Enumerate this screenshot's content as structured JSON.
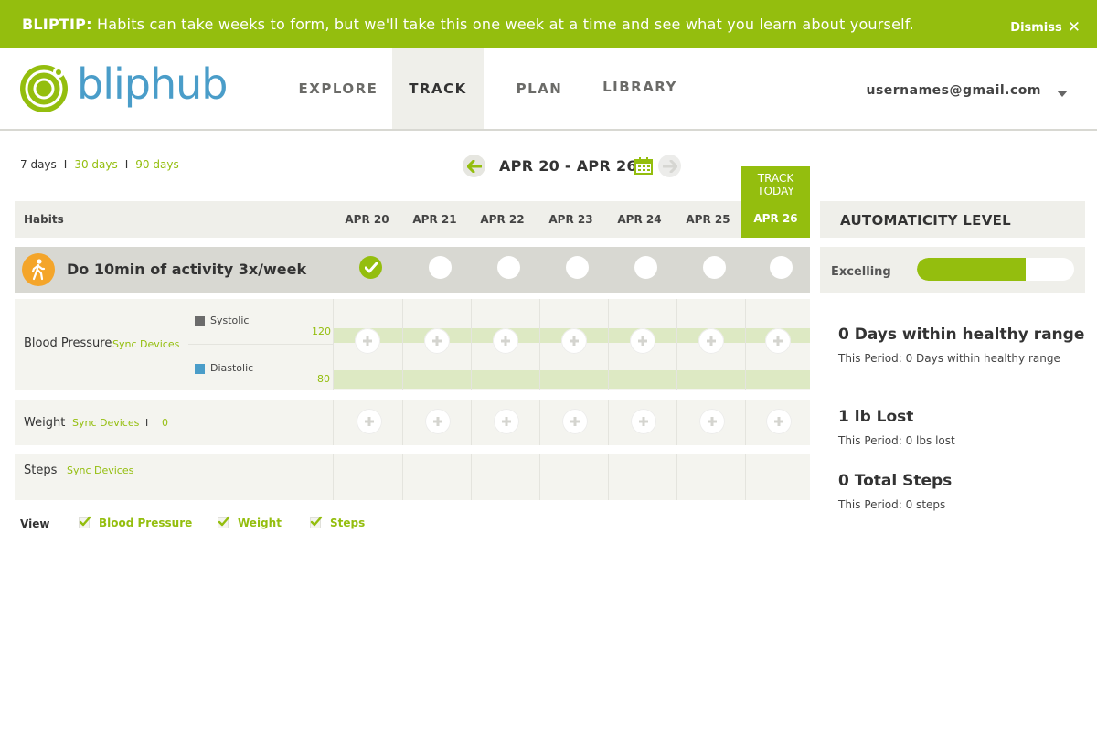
{
  "banner": {
    "prefix": "BLIPTIP:",
    "message": "Habits can take weeks to form, but we'll take this one week at a time and see what you learn about yourself.",
    "dismiss": "Dismiss"
  },
  "header": {
    "brand": "bliphub",
    "nav": [
      "EXPLORE",
      "TRACK",
      "PLAN",
      "LIBRARY"
    ],
    "active_nav": "TRACK",
    "user_email": "usernames@gmail.com"
  },
  "range": {
    "selected": "7 days",
    "options": [
      "30 days",
      "90 days"
    ],
    "separator": "I"
  },
  "date_range": "APR 20 - APR 26",
  "grid": {
    "habits_header": "Habits",
    "days": [
      "APR 20",
      "APR 21",
      "APR 22",
      "APR 23",
      "APR 24",
      "APR 25"
    ],
    "today": {
      "label_line1": "TRACK",
      "label_line2": "TODAY",
      "date": "APR 26"
    }
  },
  "habit": {
    "name": "Do 10min of activity 3x/week",
    "completed": [
      true,
      false,
      false,
      false,
      false,
      false,
      false
    ]
  },
  "automaticity": {
    "title": "AUTOMATICITY LEVEL",
    "level": "Excelling",
    "progress": 0.69
  },
  "metrics": {
    "blood_pressure": {
      "name": "Blood Pressure",
      "sync": "Sync Devices",
      "systolic": "Systolic",
      "diastolic": "Diastolic",
      "systolic_value": "120",
      "diastolic_value": "80",
      "systolic_color": "#6b6b6b",
      "diastolic_color": "#4a9dc9"
    },
    "weight": {
      "name": "Weight",
      "sync": "Sync Devices",
      "sep": "I",
      "value": "0"
    },
    "steps": {
      "name": "Steps",
      "sync": "Sync Devices"
    }
  },
  "stats": [
    {
      "headline": "0 Days within healthy range",
      "sub": "This Period: 0 Days within healthy range"
    },
    {
      "headline": "1 lb Lost",
      "sub": "This Period: 0 lbs lost"
    },
    {
      "headline": "0 Total Steps",
      "sub": "This Period: 0 steps"
    }
  ],
  "view": {
    "label": "View",
    "options": [
      "Blood Pressure",
      "Weight",
      "Steps"
    ]
  },
  "colors": {
    "accent": "#94be0e",
    "brand_blue": "#4a9dc9",
    "habit_orange": "#f4a52a"
  }
}
